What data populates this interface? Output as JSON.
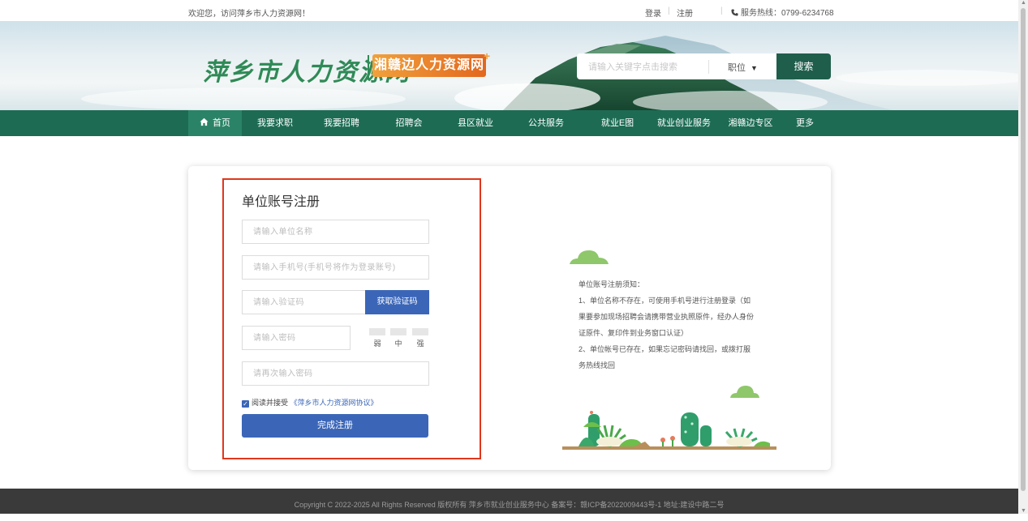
{
  "topbar": {
    "welcome": "欢迎您，访问萍乡市人力资源网！",
    "login": "登录",
    "register": "注册",
    "hotline": "服务热线：0799-6234768"
  },
  "banner": {
    "logo_main": "萍乡市人力资源网",
    "logo_badge": "湘赣边人力资源网",
    "search_placeholder": "请输入关键字点击搜索",
    "search_category": "职位",
    "search_button": "搜索"
  },
  "nav": {
    "items": [
      {
        "label": "首页",
        "active": true
      },
      {
        "label": "我要求职"
      },
      {
        "label": "我要招聘"
      },
      {
        "label": "招聘会"
      },
      {
        "label": "县区就业"
      },
      {
        "label": "公共服务"
      },
      {
        "label": "就业E图"
      },
      {
        "label": "就业创业服务"
      },
      {
        "label": "湘赣边专区"
      },
      {
        "label": "更多"
      }
    ]
  },
  "form": {
    "title": "单位账号注册",
    "company_placeholder": "请输入单位名称",
    "phone_placeholder": "请输入手机号(手机号将作为登录账号)",
    "code_placeholder": "请输入验证码",
    "code_button": "获取验证码",
    "password_placeholder": "请输入密码",
    "strength": [
      "弱",
      "中",
      "强"
    ],
    "confirm_placeholder": "请再次输入密码",
    "agree_text": "阅读并接受",
    "agree_link": "《萍乡市人力资源网协议》",
    "submit": "完成注册"
  },
  "notes": {
    "heading": "单位账号注册须知：",
    "line1": "1、单位名称不存在，可使用手机号进行注册登录（如",
    "line2": "果要参加现场招聘会请携带营业执照原件，经办人身份",
    "line3": "证原件、复印件到业务窗口认证）",
    "line4": "2、单位帐号已存在，如果忘记密码请找回，或拨打服",
    "line5": "务热线找回"
  },
  "footer": {
    "text": "Copyright C 2022-2025 All Rights Reserved 版权所有 萍乡市就业创业服务中心 备案号：赣ICP备2022009443号-1 地址:建设中路二号"
  },
  "colors": {
    "nav_bg": "#1d6b53",
    "primary_blue": "#3b66b8",
    "highlight_red": "#e0371c",
    "logo_green": "#2f8a57",
    "badge_orange": "#e3671e"
  },
  "icons": [
    "phone-icon",
    "home-icon",
    "caret-down-icon",
    "checkbox-checked-icon"
  ]
}
